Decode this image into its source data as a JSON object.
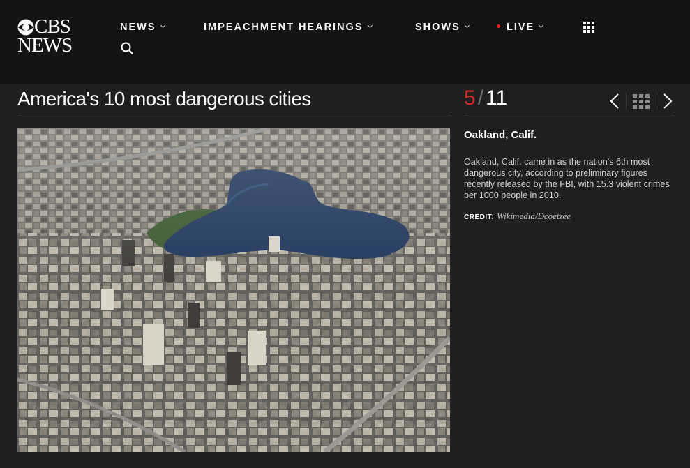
{
  "brand": {
    "line1": "CBS",
    "line2": "NEWS"
  },
  "nav": {
    "items": [
      {
        "label": "NEWS"
      },
      {
        "label": "IMPEACHMENT HEARINGS"
      },
      {
        "label": "SHOWS"
      },
      {
        "label": "LIVE"
      }
    ],
    "icons": [
      "chevron-down-icon",
      "live-dot-icon",
      "grid-menu-icon",
      "search-icon"
    ]
  },
  "gallery": {
    "title": "America's 10 most dangerous cities",
    "counter": {
      "current": "5",
      "separator": "/",
      "total": "11"
    },
    "controls": [
      "chevron-left-icon",
      "grid-thumbnails-icon",
      "chevron-right-icon"
    ]
  },
  "slide": {
    "heading": "Oakland, Calif.",
    "caption": "Oakland, Calif. came in as the nation's 6th most dangerous city, according to preliminary figures recently released by the FBI, with 15.3 violent crimes per 1000 people in 2010.",
    "credit_label": "CREDIT:",
    "credit_value": "Wikimedia/Dcoetzee"
  },
  "colors": {
    "header_bg": "#141414",
    "page_bg": "#1f1f1f",
    "accent_red": "#d42a2a",
    "live_red": "#e02020"
  }
}
